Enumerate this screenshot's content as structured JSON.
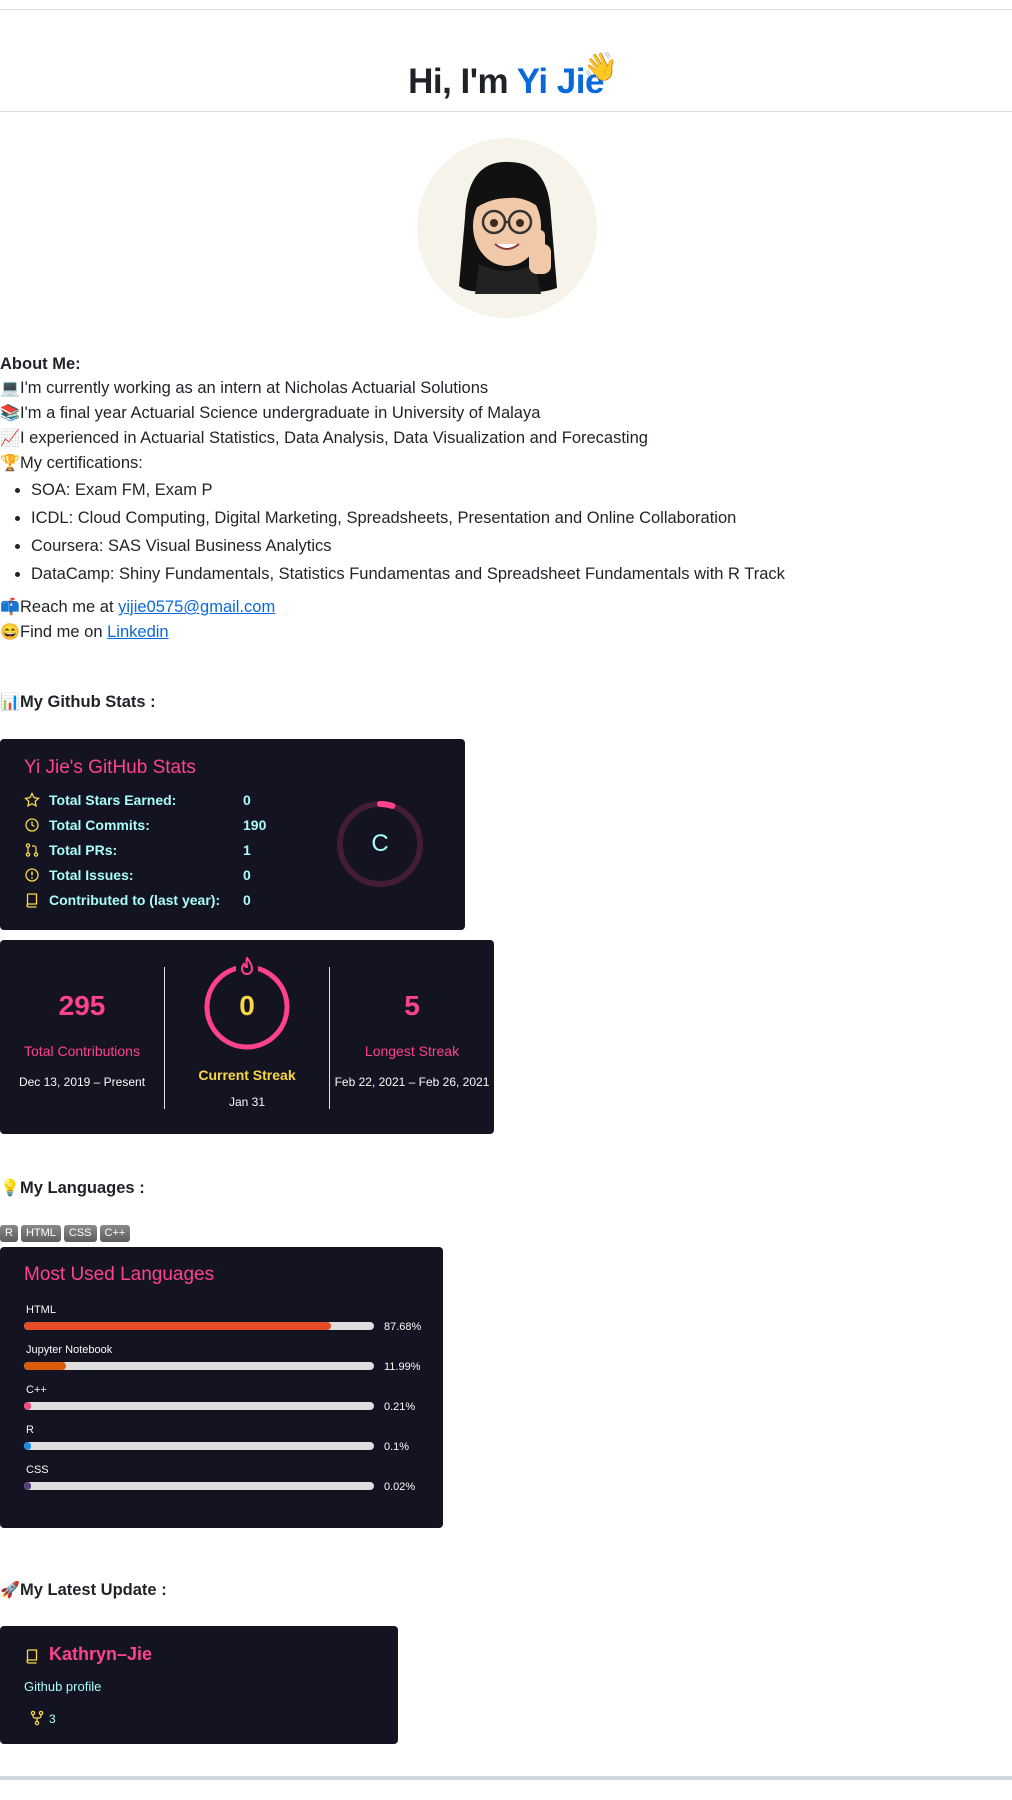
{
  "header": {
    "greeting": "Hi, I'm ",
    "name": "Yi Jie",
    "wave_emoji": "👋"
  },
  "about": {
    "heading": "About Me:",
    "lines": [
      {
        "emoji": "💻",
        "text": "I'm currently working as an intern at Nicholas Actuarial Solutions"
      },
      {
        "emoji": "📚",
        "text": "I'm a final year Actuarial Science undergraduate in University of Malaya"
      },
      {
        "emoji": "📈",
        "text": "I experienced in Actuarial Statistics, Data Analysis, Data Visualization and Forecasting"
      },
      {
        "emoji": "🏆",
        "text": "My certifications:"
      }
    ],
    "certifications": [
      "SOA: Exam FM, Exam P",
      "ICDL: Cloud Computing, Digital Marketing, Spreadsheets, Presentation and Online Collaboration",
      "Coursera: SAS Visual Business Analytics",
      "DataCamp: Shiny Fundamentals, Statistics Fundamentas and Spreadsheet Fundamentals with R Track"
    ]
  },
  "contact": {
    "reach_emoji": "📫",
    "reach_prefix": "Reach me at ",
    "email": "yijie0575@gmail.com",
    "find_emoji": "😄",
    "find_prefix": "Find me on ",
    "linkedin": "Linkedin"
  },
  "sections": {
    "github_stats": {
      "emoji": "📊",
      "label": "My Github Stats :"
    },
    "languages": {
      "emoji": "💡",
      "label": "My Languages :"
    },
    "latest_update": {
      "emoji": "🚀",
      "label": "My Latest Update :"
    }
  },
  "stats_card": {
    "title": "Yi Jie's GitHub Stats",
    "rows": [
      {
        "icon": "star-icon",
        "label": "Total Stars Earned:",
        "value": "0"
      },
      {
        "icon": "history-icon",
        "label": "Total Commits:",
        "value": "190"
      },
      {
        "icon": "pull-request-icon",
        "label": "Total PRs:",
        "value": "1"
      },
      {
        "icon": "issue-icon",
        "label": "Total Issues:",
        "value": "0"
      },
      {
        "icon": "repo-icon",
        "label": "Contributed to (last year):",
        "value": "0"
      }
    ],
    "rank": "C",
    "rank_progress": 0.05
  },
  "streak_card": {
    "total_contributions": "295",
    "total_label": "Total Contributions",
    "total_range": "Dec 13, 2019 – Present",
    "current_streak": "0",
    "current_label": "Current Streak",
    "current_date": "Jan 31",
    "longest_streak": "5",
    "longest_label": "Longest Streak",
    "longest_range": "Feb 22, 2021 – Feb 26, 2021"
  },
  "badges": [
    "R",
    "HTML",
    "CSS",
    "C++"
  ],
  "languages_card": {
    "title": "Most Used Languages",
    "languages": [
      {
        "name": "HTML",
        "percent": 87.68,
        "label": "87.68%",
        "color": "#e34c26"
      },
      {
        "name": "Jupyter Notebook",
        "percent": 11.99,
        "label": "11.99%",
        "color": "#DA5B0B"
      },
      {
        "name": "C++",
        "percent": 0.21,
        "label": "0.21%",
        "color": "#f34b7d"
      },
      {
        "name": "R",
        "percent": 0.1,
        "label": "0.1%",
        "color": "#198CE7"
      },
      {
        "name": "CSS",
        "percent": 0.02,
        "label": "0.02%",
        "color": "#563d7c"
      }
    ]
  },
  "repo_card": {
    "name": "Kathryn–Jie",
    "description": "Github profile",
    "forks": "3"
  },
  "colors": {
    "card_bg": "#141321",
    "pink": "#fe428e",
    "cyan": "#a9fef7",
    "yellow": "#f8d847",
    "link": "#0969da"
  }
}
